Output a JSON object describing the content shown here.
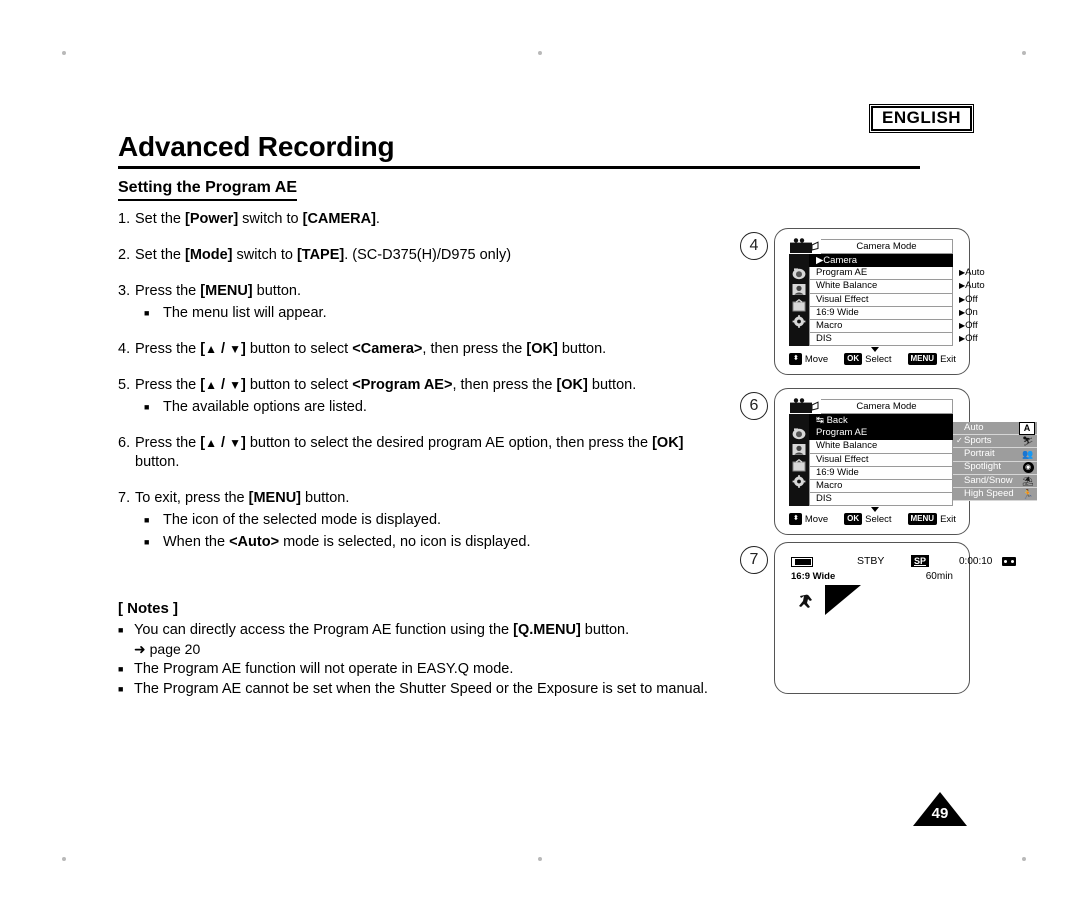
{
  "header": {
    "language_badge": "ENGLISH",
    "chapter_title": "Advanced Recording",
    "section_title": "Setting the Program AE"
  },
  "steps": [
    {
      "num": "1.",
      "html": "Set the <b>[Power]</b> switch to <b>[CAMERA]</b>.",
      "subs": []
    },
    {
      "num": "2.",
      "html": "Set the <b>[Mode]</b> switch to <b>[TAPE]</b>. (SC-D375(H)/D975 only)",
      "subs": []
    },
    {
      "num": "3.",
      "html": "Press the <b>[MENU]</b> button.",
      "subs": [
        "The menu list will appear."
      ]
    },
    {
      "num": "4.",
      "html": "Press the <b>[<span class=\"tri\">▲</span> / <span class=\"tri\">▼</span>]</b> button to select <b>&lt;Camera&gt;</b>, then press the <b>[OK]</b> button.",
      "subs": []
    },
    {
      "num": "5.",
      "html": "Press the <b>[<span class=\"tri\">▲</span> / <span class=\"tri\">▼</span>]</b> button to select <b>&lt;Program AE&gt;</b>, then press the <b>[OK]</b> button.",
      "subs": [
        "The available options are listed."
      ]
    },
    {
      "num": "6.",
      "html": "Press the <b>[<span class=\"tri\">▲</span> / <span class=\"tri\">▼</span>]</b> button to select the desired program AE option, then press the <b>[OK]</b> button.",
      "subs": []
    },
    {
      "num": "7.",
      "html": "To exit, press the <b>[MENU]</b> button.",
      "subs": [
        "The icon of the selected mode is displayed.",
        "When the <b>&lt;Auto&gt;</b> mode is selected, no icon is displayed."
      ]
    }
  ],
  "notes": {
    "heading": "[ Notes ]",
    "items": [
      "You can directly access the Program AE function using the <b>[Q.MENU]</b> button.",
      "The Program AE function will not operate in EASY.Q mode.",
      "The Program AE cannot be set when the Shutter Speed or the Exposure is set to manual."
    ],
    "page_ref": "➜ page 20"
  },
  "page_number": "49",
  "panels": [
    {
      "number": "4",
      "type": "menu",
      "screen_title": "Camera Mode",
      "menu_rows": [
        {
          "label": "▶Camera",
          "selected": true,
          "value": ""
        },
        {
          "label": "Program AE",
          "selected": false,
          "value": "Auto"
        },
        {
          "label": "White Balance",
          "selected": false,
          "value": "Auto"
        },
        {
          "label": "Visual Effect",
          "selected": false,
          "value": "Off"
        },
        {
          "label": "16:9 Wide",
          "selected": false,
          "value": "On"
        },
        {
          "label": "Macro",
          "selected": false,
          "value": "Off"
        },
        {
          "label": "DIS",
          "selected": false,
          "value": "Off"
        }
      ],
      "footer": {
        "move": "Move",
        "ok_key": "OK",
        "ok_label": "Select",
        "menu_key": "MENU",
        "menu_label": "Exit"
      }
    },
    {
      "number": "6",
      "type": "menu-sub",
      "screen_title": "Camera Mode",
      "menu_rows": [
        {
          "label": "↹ Back",
          "selected": true,
          "value": ""
        },
        {
          "label": "Program AE",
          "selected": true,
          "value": ""
        },
        {
          "label": "White Balance",
          "selected": false,
          "value": ""
        },
        {
          "label": "Visual Effect",
          "selected": false,
          "value": ""
        },
        {
          "label": "16:9 Wide",
          "selected": false,
          "value": ""
        },
        {
          "label": "Macro",
          "selected": false,
          "value": ""
        },
        {
          "label": "DIS",
          "selected": false,
          "value": ""
        }
      ],
      "submenu": [
        {
          "label": "Auto",
          "checked": false,
          "icon": "A",
          "icon_kind": "letter"
        },
        {
          "label": "Sports",
          "checked": true,
          "icon": "⛷",
          "icon_kind": "glyph"
        },
        {
          "label": "Portrait",
          "checked": false,
          "icon": "👥",
          "icon_kind": "glyph"
        },
        {
          "label": "Spotlight",
          "checked": false,
          "icon": "◉",
          "icon_kind": "circle"
        },
        {
          "label": "Sand/Snow",
          "checked": false,
          "icon": "⛱",
          "icon_kind": "glyph"
        },
        {
          "label": "High Speed",
          "checked": false,
          "icon": "🏃",
          "icon_kind": "glyph"
        }
      ],
      "footer": {
        "move": "Move",
        "ok_key": "OK",
        "ok_label": "Select",
        "menu_key": "MENU",
        "menu_label": "Exit"
      }
    },
    {
      "number": "7",
      "type": "viewfinder",
      "status": "STBY",
      "quality": "SP",
      "timecode": "0:00:10",
      "wide": "16:9 Wide",
      "remaining": "60min"
    }
  ]
}
